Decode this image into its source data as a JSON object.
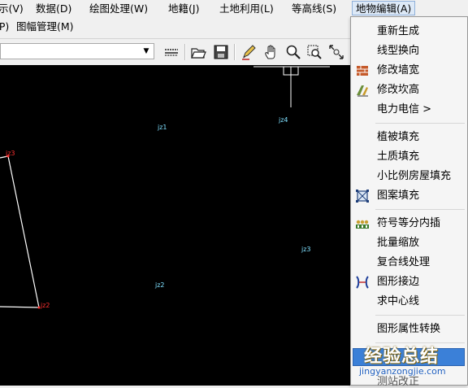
{
  "menubar": {
    "items": [
      {
        "label": "示(V)"
      },
      {
        "label": "数据(D)"
      },
      {
        "label": "绘图处理(W)"
      },
      {
        "label": "地籍(J)"
      },
      {
        "label": "土地利用(L)"
      },
      {
        "label": "等高线(S)"
      },
      {
        "label": "地物编辑(A)"
      }
    ],
    "row2": [
      {
        "label": "(P)"
      },
      {
        "label": "图幅管理(M)"
      }
    ]
  },
  "toolbar": {
    "combo_value": "",
    "icons": [
      "lines-icon",
      "open-folder-icon",
      "save-icon",
      "pencil-icon",
      "hand-pan-icon",
      "zoom-icon",
      "zoom-window-icon",
      "zoom-extents-icon"
    ]
  },
  "canvas": {
    "labels": [
      {
        "text": "jz1",
        "color": "#7fe0ff"
      },
      {
        "text": "jz4",
        "color": "#7fe0ff"
      },
      {
        "text": "jz3",
        "color": "#7fe0ff"
      },
      {
        "text": "jz2",
        "color": "#7fe0ff"
      },
      {
        "text": "jz3",
        "color": "#ff3030"
      },
      {
        "text": "jz2",
        "color": "#ff3030"
      }
    ]
  },
  "dropdown": {
    "items": [
      {
        "label": "重新生成",
        "icon": null
      },
      {
        "label": "线型换向",
        "icon": null
      },
      {
        "label": "修改墙宽",
        "icon": "wall-width-icon"
      },
      {
        "label": "修改坎高",
        "icon": "slope-height-icon"
      },
      {
        "label": "电力电信 >",
        "icon": null
      },
      {
        "label": "植被填充",
        "icon": null
      },
      {
        "label": "土质填充",
        "icon": null
      },
      {
        "label": "小比例房屋填充",
        "icon": null
      },
      {
        "label": "图案填充",
        "icon": "hatch-icon"
      },
      {
        "label": "符号等分内插",
        "icon": "symbol-interp-icon"
      },
      {
        "label": "批量缩放",
        "icon": null
      },
      {
        "label": "复合线处理",
        "icon": null
      },
      {
        "label": "图形接边",
        "icon": "edge-match-icon"
      },
      {
        "label": "求中心线",
        "icon": null
      },
      {
        "label": "图形属性转换",
        "icon": null
      },
      {
        "label": "测站改正",
        "icon": null
      }
    ]
  },
  "watermark": {
    "title": "经验总结",
    "url": "jingyanzongjie.com"
  }
}
